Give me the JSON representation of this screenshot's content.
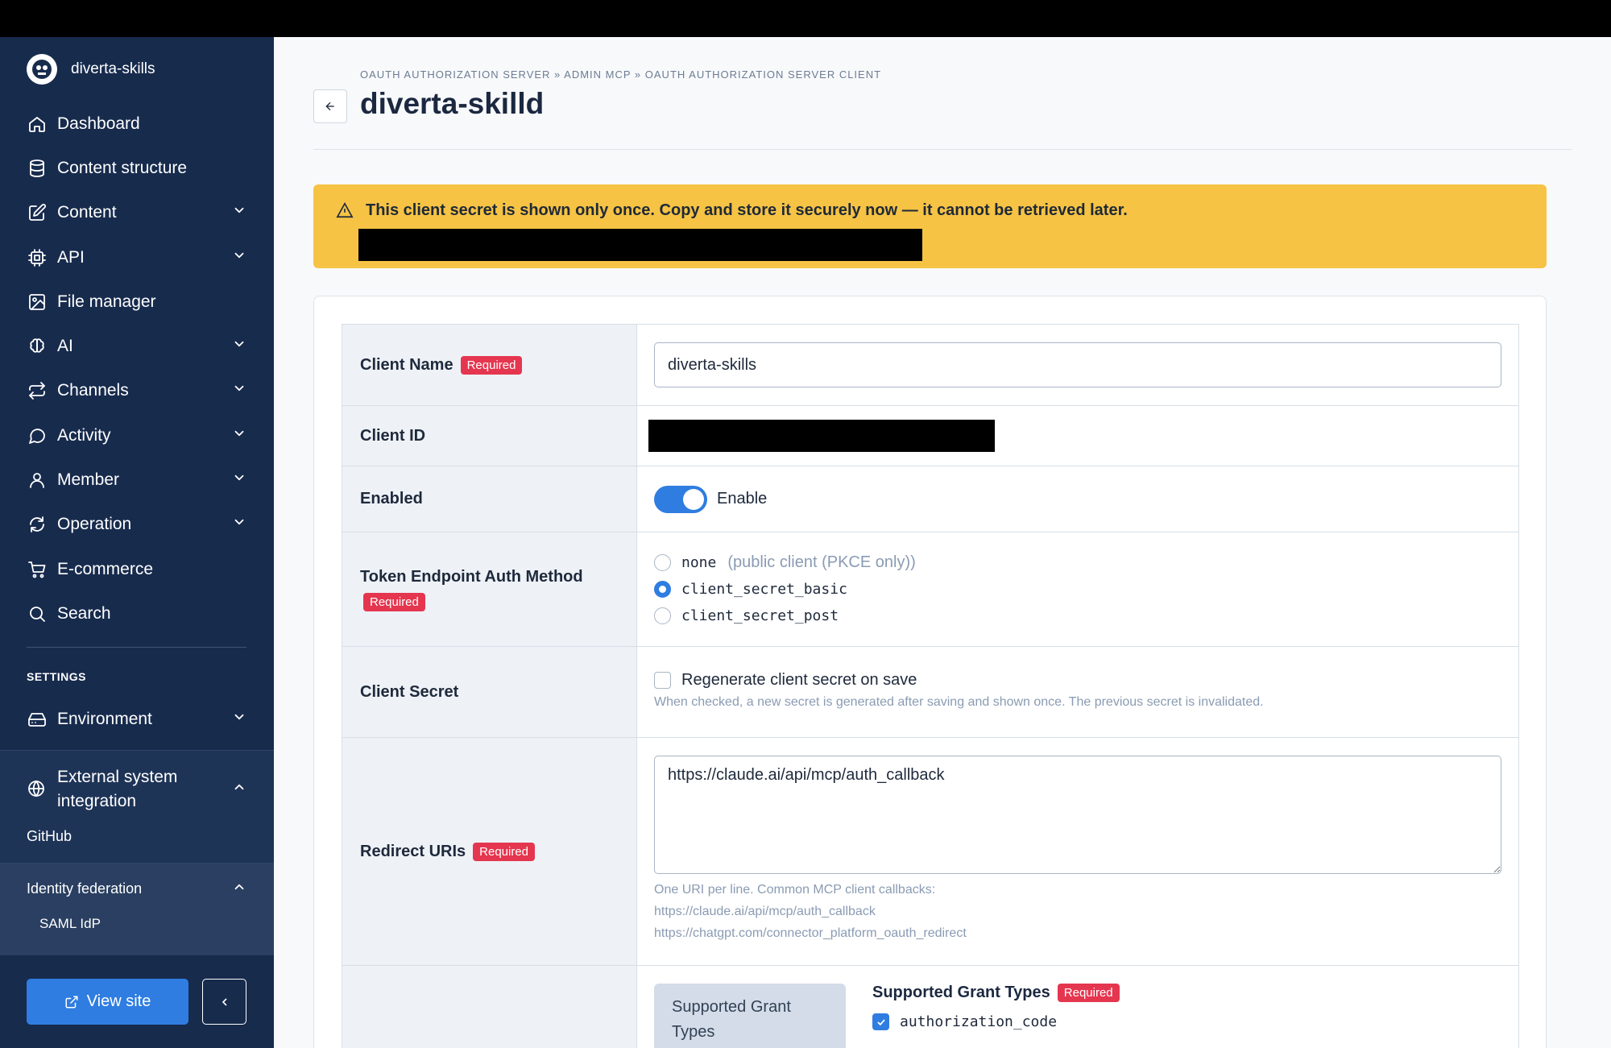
{
  "sidebar": {
    "brand": "diverta-skills",
    "items": [
      {
        "label": "Dashboard",
        "icon": "home-icon"
      },
      {
        "label": "Content structure",
        "icon": "database-icon"
      },
      {
        "label": "Content",
        "icon": "edit-icon"
      },
      {
        "label": "API",
        "icon": "cpu-icon"
      },
      {
        "label": "File manager",
        "icon": "image-icon"
      },
      {
        "label": "AI",
        "icon": "brain-icon"
      },
      {
        "label": "Channels",
        "icon": "repeat-icon"
      },
      {
        "label": "Activity",
        "icon": "chat-icon"
      },
      {
        "label": "Member",
        "icon": "user-icon"
      },
      {
        "label": "Operation",
        "icon": "refresh-icon"
      },
      {
        "label": "E-commerce",
        "icon": "cart-icon"
      },
      {
        "label": "Search",
        "icon": "search-icon"
      }
    ],
    "settings_title": "SETTINGS",
    "environment": "Environment",
    "external": "External system integration",
    "github": "GitHub",
    "identity_federation": "Identity federation",
    "saml_idp": "SAML IdP",
    "view_site": "View site"
  },
  "header": {
    "breadcrumb": "OAUTH AUTHORIZATION SERVER » ADMIN MCP » OAUTH AUTHORIZATION SERVER CLIENT",
    "title": "diverta-skilld"
  },
  "alert": {
    "text": "This client secret is shown only once. Copy and store it securely now — it cannot be retrieved later.",
    "color": "#f6c344"
  },
  "form": {
    "required_badge": "Required",
    "client_name_label": "Client Name",
    "client_name_value": "diverta-skills",
    "client_id_label": "Client ID",
    "enabled_label": "Enabled",
    "enable_text": "Enable",
    "auth_method_label": "Token Endpoint Auth Method",
    "auth_none": "none",
    "auth_none_hint": "(public client (PKCE only))",
    "auth_basic": "client_secret_basic",
    "auth_post": "client_secret_post",
    "auth_selected": "client_secret_basic",
    "client_secret_label": "Client Secret",
    "regen_label": "Regenerate client secret on save",
    "regen_help": "When checked, a new secret is generated after saving and shown once. The previous secret is invalidated.",
    "redirect_label": "Redirect URIs",
    "redirect_value": "https://claude.ai/api/mcp/auth_callback",
    "redirect_help_1": "One URI per line. Common MCP client callbacks:",
    "redirect_help_2": "https://claude.ai/api/mcp/auth_callback",
    "redirect_help_3": "https://chatgpt.com/connector_platform_oauth_redirect",
    "grant_tab": "Supported Grant Types",
    "grant_title": "Supported Grant Types",
    "grant_auth_code": "authorization_code"
  },
  "colors": {
    "sidebar_bg": "#172b4d",
    "accent": "#2f7de1",
    "required": "#e5364f"
  }
}
